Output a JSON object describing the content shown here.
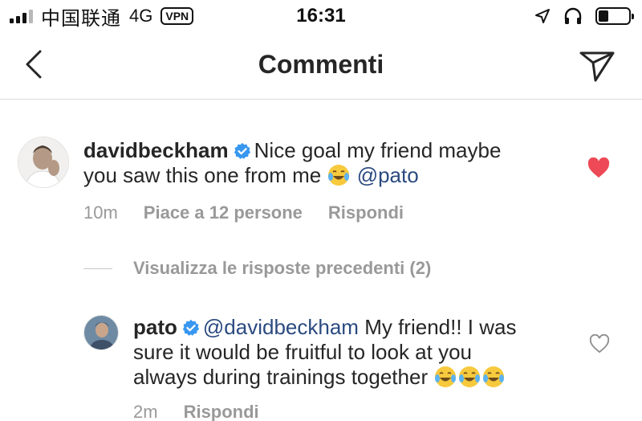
{
  "status_bar": {
    "carrier": "中国联通",
    "network": "4G",
    "vpn": "VPN",
    "time": "16:31"
  },
  "header": {
    "title": "Commenti",
    "icons": [
      "back-chevron-icon",
      "send-icon"
    ]
  },
  "comments": [
    {
      "username": "davidbeckham",
      "verified": true,
      "text_before": "Nice goal my friend maybe",
      "text_line2": "you saw this one from me",
      "emoji": "tears-of-joy",
      "mention": "@pato",
      "time": "10m",
      "likes": "Piace a 12 persone",
      "reply": "Rispondi",
      "liked": true,
      "heart_color": "#ed4956"
    }
  ],
  "view_replies": "Visualizza le risposte precedenti (2)",
  "replies": [
    {
      "username": "pato",
      "verified": true,
      "mention": "@davidbeckham",
      "text_line1": "My friend!! I was",
      "text_line2": "sure it would be fruitful to look at you",
      "text_line3": "always during trainings together",
      "emoji_count": 3,
      "time": "2m",
      "reply": "Rispondi",
      "liked": false
    }
  ],
  "colors": {
    "verified_blue": "#3897f0",
    "mention": "#2b4a80",
    "secondary_text": "#999999",
    "like_red": "#ed4956"
  }
}
